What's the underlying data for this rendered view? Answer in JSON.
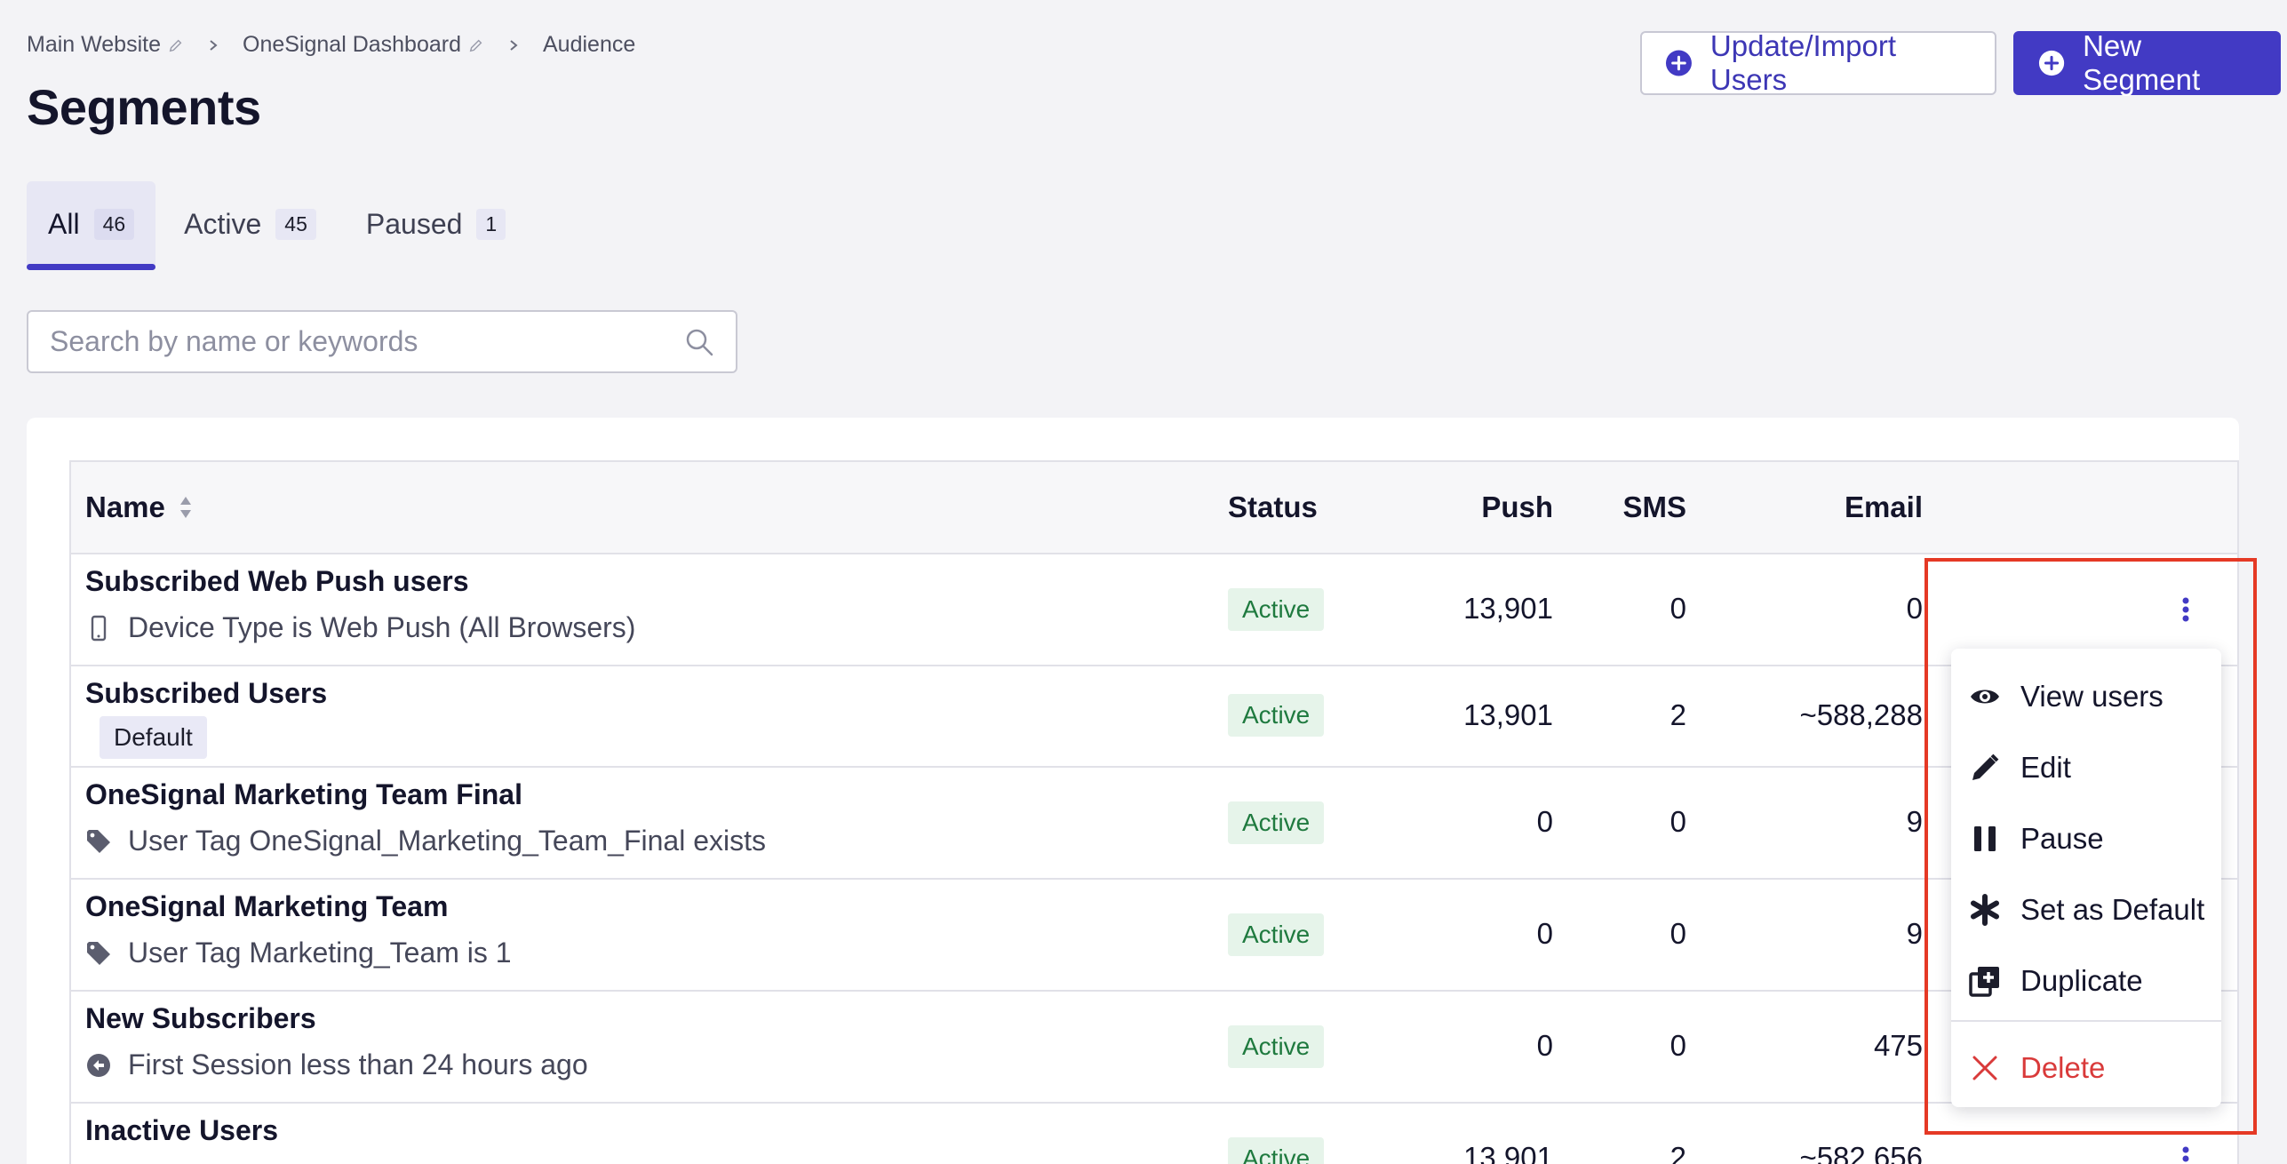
{
  "breadcrumb": {
    "items": [
      "Main Website",
      "OneSignal Dashboard",
      "Audience"
    ]
  },
  "page": {
    "title": "Segments"
  },
  "actions": {
    "import_label": "Update/Import Users",
    "new_segment_label": "New Segment"
  },
  "tabs": [
    {
      "label": "All",
      "count": "46"
    },
    {
      "label": "Active",
      "count": "45"
    },
    {
      "label": "Paused",
      "count": "1"
    }
  ],
  "search": {
    "placeholder": "Search by name or keywords",
    "value": ""
  },
  "table": {
    "headers": {
      "name": "Name",
      "status": "Status",
      "push": "Push",
      "sms": "SMS",
      "email": "Email"
    },
    "rows": [
      {
        "name": "Subscribed Web Push users",
        "desc": "Device Type is Web Push (All Browsers)",
        "desc_icon": "device-icon",
        "status": "Active",
        "push": "13,901",
        "sms": "0",
        "email": "0"
      },
      {
        "name": "Subscribed Users",
        "badge": "Default",
        "status": "Active",
        "push": "13,901",
        "sms": "2",
        "email": "~588,288"
      },
      {
        "name": "OneSignal Marketing Team Final",
        "desc": "User Tag OneSignal_Marketing_Team_Final exists",
        "desc_icon": "tag-icon",
        "status": "Active",
        "push": "0",
        "sms": "0",
        "email": "9"
      },
      {
        "name": "OneSignal Marketing Team",
        "desc": "User Tag Marketing_Team is 1",
        "desc_icon": "tag-icon",
        "status": "Active",
        "push": "0",
        "sms": "0",
        "email": "9"
      },
      {
        "name": "New Subscribers",
        "desc": "First Session less than 24 hours ago",
        "desc_icon": "history-icon",
        "status": "Active",
        "push": "0",
        "sms": "0",
        "email": "475"
      },
      {
        "name": "Inactive Users",
        "status": "Active",
        "push": "13,901",
        "sms": "2",
        "email": "~582,656"
      }
    ]
  },
  "menu": {
    "items": [
      {
        "label": "View users",
        "icon": "eye-icon"
      },
      {
        "label": "Edit",
        "icon": "pencil-icon"
      },
      {
        "label": "Pause",
        "icon": "pause-icon"
      },
      {
        "label": "Set as Default",
        "icon": "asterisk-icon"
      },
      {
        "label": "Duplicate",
        "icon": "duplicate-icon"
      },
      {
        "label": "Delete",
        "icon": "close-icon"
      }
    ]
  },
  "colors": {
    "primary": "#423ac4",
    "status_active_text": "#1f7a3f",
    "status_active_bg": "#e6f4ea",
    "danger": "#d93a3a",
    "highlight": "#e53925"
  }
}
